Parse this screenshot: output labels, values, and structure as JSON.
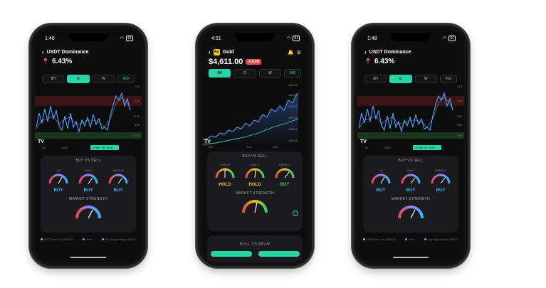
{
  "colors": {
    "accent": "#26d6a6",
    "buy": "#39b6ff",
    "hold": "#f0c419",
    "red": "#e84b4b",
    "line": "#4da3ff"
  },
  "phone_left": {
    "status_time": "1:48",
    "battery": "61",
    "title": "USDT Dominance",
    "value": "6.43%",
    "tabs": [
      "8H",
      "D",
      "W"
    ],
    "active_tab": "D",
    "indicator_tab": "IND",
    "x_ticks": [
      "Jul",
      "2025"
    ],
    "tooltip": "21 Nov '25 · 00:00",
    "y_ticks": [
      "7.00",
      "6.43",
      "6.00",
      "5.00",
      "4.50"
    ],
    "buy_sell_title": "BUY VS SELL",
    "gauges": [
      {
        "label": "1H",
        "signal": "BUY"
      },
      {
        "label": "DAILY",
        "signal": "BUY"
      },
      {
        "label": "WEEKLY",
        "signal": "BUY"
      }
    ],
    "strength_title": "MARKET STRENGTH",
    "legend": [
      "USDT Dom. Vol (USDT.D)",
      "Index",
      "Key Support Major USDT.D"
    ]
  },
  "phone_mid": {
    "status_time": "4:51",
    "battery": "61",
    "title": "Gold",
    "price": "$4,611.00",
    "change": "-0.61%",
    "tabs": [
      "8H",
      "D",
      "W"
    ],
    "active_tab": "8H",
    "indicator_tab": "IND",
    "x_ticks": [
      "Dec",
      "Feb",
      "2026"
    ],
    "y_ticks": [
      "4800.00",
      "4600.00",
      "4400.00",
      "4200.00",
      "4000.00",
      "3800.00"
    ],
    "buy_sell_title": "BUY VS SELL",
    "gauges": [
      {
        "label": "4 HOUR",
        "signal": "HOLD"
      },
      {
        "label": "DAILY",
        "signal": "HOLD"
      },
      {
        "label": "WEEKLY",
        "signal": "BUY"
      }
    ],
    "strength_title": "MARKET STRENGTH",
    "bull_bear_title": "BULL VS BEAR"
  },
  "phone_right": {
    "status_time": "1:48",
    "battery": "61",
    "title": "USDT Dominance",
    "value": "6.43%",
    "tabs": [
      "8H",
      "D",
      "W"
    ],
    "active_tab": "D",
    "indicator_tab": "IND",
    "x_ticks": [
      "Jul",
      "2025"
    ],
    "tooltip": "21 Nov '25 · 00:00",
    "y_ticks": [
      "7.00",
      "6.43",
      "6.00",
      "5.00",
      "4.50"
    ],
    "buy_sell_title": "BUY VS SELL",
    "gauges": [
      {
        "label": "1H",
        "signal": "BUY"
      },
      {
        "label": "DAILY",
        "signal": "BUY"
      },
      {
        "label": "WEEKLY",
        "signal": "BUY"
      }
    ],
    "strength_title": "MARKET STRENGTH",
    "legend": [
      "USDT Dom. Vol (USDT.D)",
      "Index",
      "Key Support Major USDT.D"
    ]
  }
}
